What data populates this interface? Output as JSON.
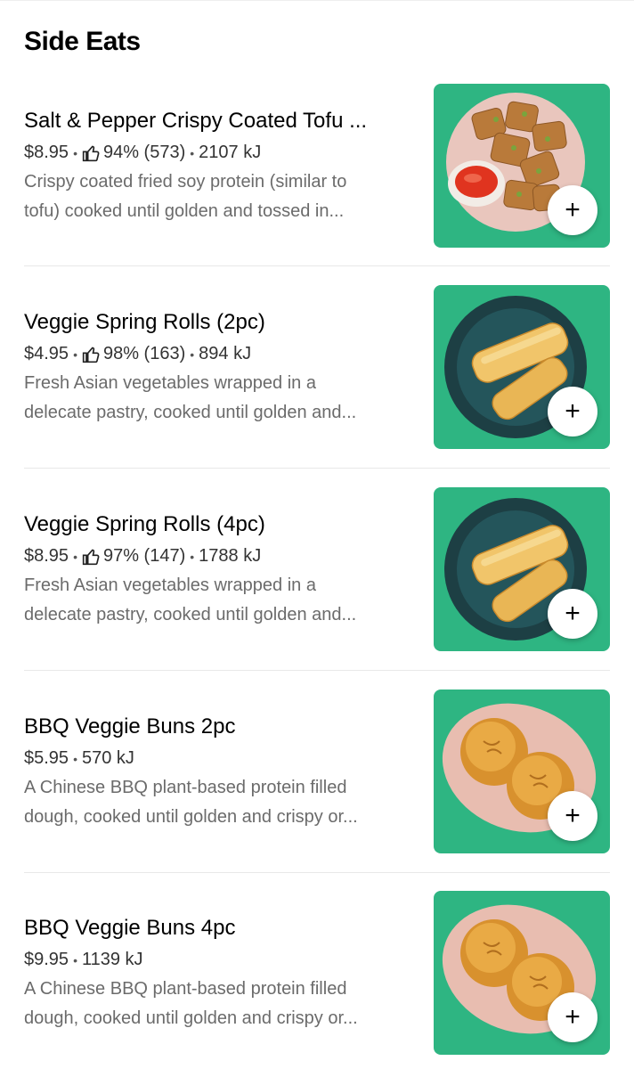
{
  "section": {
    "title": "Side Eats"
  },
  "items": [
    {
      "name": "Salt & Pepper Crispy Coated Tofu ...",
      "price": "$8.95",
      "rating": "94% (573)",
      "energy": "2107 kJ",
      "desc_line1": "Crispy coated fried soy protein (similar to",
      "desc_line2": "tofu) cooked until golden and tossed in...",
      "image_kind": "tofu",
      "add_label": "+"
    },
    {
      "name": "Veggie Spring Rolls (2pc)",
      "price": "$4.95",
      "rating": "98% (163)",
      "energy": "894 kJ",
      "desc_line1": "Fresh Asian vegetables wrapped in a",
      "desc_line2": "delecate pastry, cooked until golden and...",
      "image_kind": "springrolls",
      "add_label": "+"
    },
    {
      "name": "Veggie Spring Rolls (4pc)",
      "price": "$8.95",
      "rating": "97% (147)",
      "energy": "1788 kJ",
      "desc_line1": "Fresh Asian vegetables wrapped in a",
      "desc_line2": "delecate pastry, cooked until golden and...",
      "image_kind": "springrolls",
      "add_label": "+"
    },
    {
      "name": "BBQ Veggie Buns 2pc",
      "price": "$5.95",
      "energy": "570 kJ",
      "desc_line1": "A Chinese BBQ plant-based protein filled",
      "desc_line2": "dough, cooked until golden and crispy or...",
      "image_kind": "buns",
      "add_label": "+"
    },
    {
      "name": "BBQ Veggie Buns 4pc",
      "price": "$9.95",
      "energy": "1139 kJ",
      "desc_line1": "A Chinese BBQ plant-based protein filled",
      "desc_line2": "dough, cooked until golden and crispy or...",
      "image_kind": "buns",
      "add_label": "+"
    }
  ],
  "colors": {
    "tile_green": "#2eb582",
    "desc_gray": "#6b6b6b"
  }
}
